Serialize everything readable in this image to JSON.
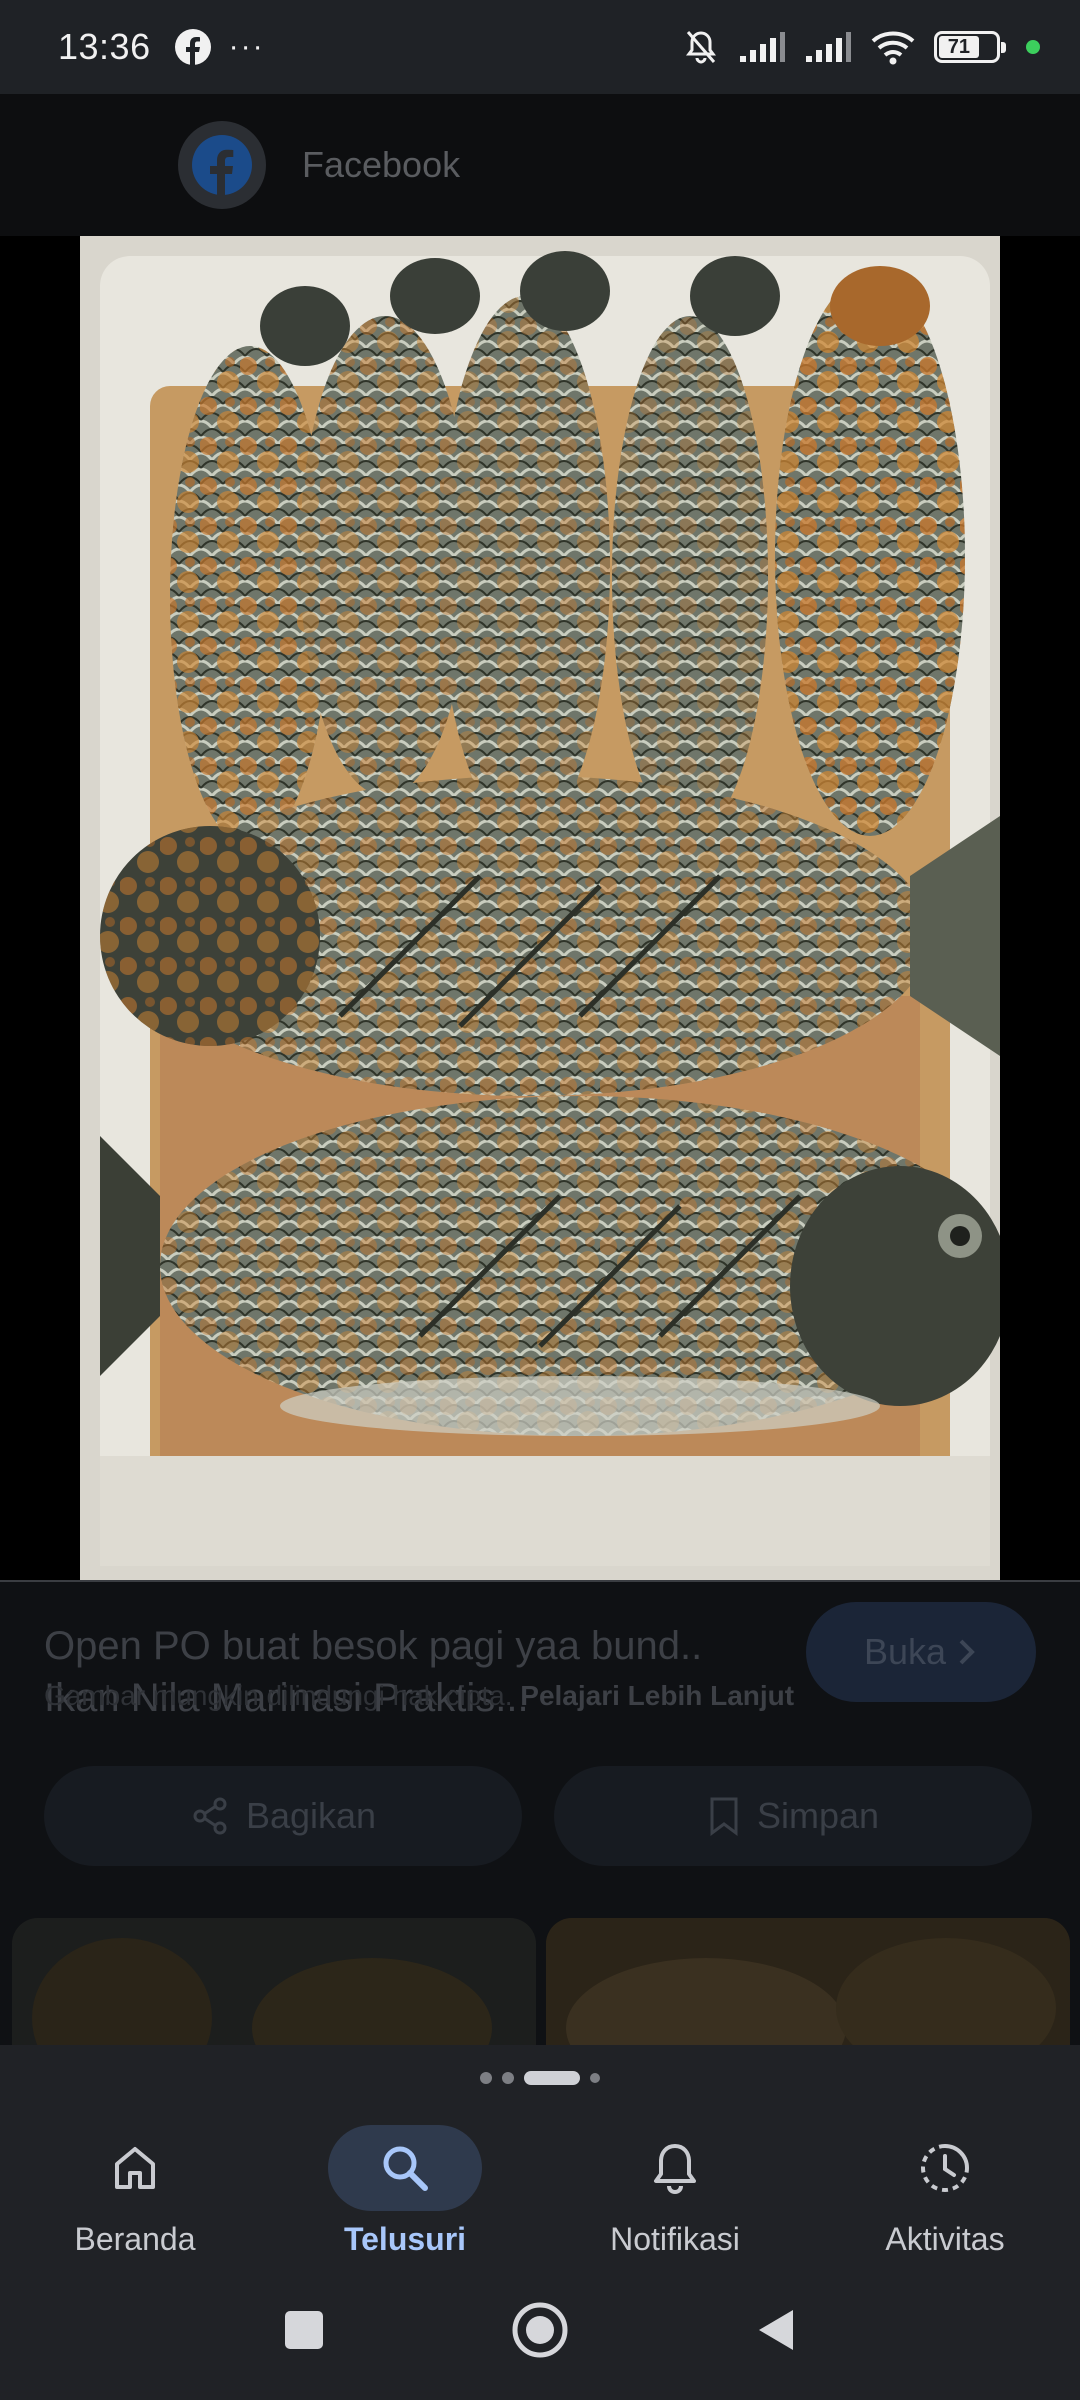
{
  "status_bar": {
    "time": "13:36",
    "more": "···",
    "battery": "71"
  },
  "source": {
    "name": "Facebook"
  },
  "detail": {
    "title": "Open PO buat besok pagi yaa bund.. Ikan Nila Marinasi Praktis...",
    "visit_label": "Buka",
    "copyright_text": "Gambar mungkin dilindungi hak cipta.",
    "learn_more": "Pelajari Lebih Lanjut",
    "share_label": "Bagikan",
    "save_label": "Simpan"
  },
  "bottom_nav": {
    "items": [
      {
        "label": "Beranda",
        "icon": "home-icon",
        "active": false
      },
      {
        "label": "Telusuri",
        "icon": "search-icon",
        "active": true
      },
      {
        "label": "Notifikasi",
        "icon": "bell-icon",
        "active": false
      },
      {
        "label": "Aktivitas",
        "icon": "activity-icon",
        "active": false
      }
    ]
  },
  "colors": {
    "accent": "#a8c7fa",
    "nav_bg": "#202226",
    "status_bg": "#1f2226"
  }
}
